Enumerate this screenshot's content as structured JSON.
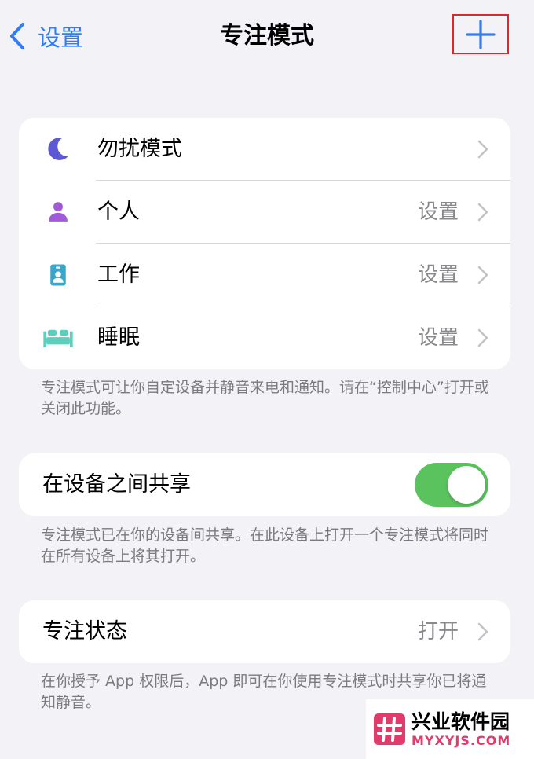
{
  "nav": {
    "back_label": "设置",
    "title": "专注模式",
    "add_icon": "plus-icon"
  },
  "focus_modes": [
    {
      "label": "勿扰模式",
      "value": "",
      "icon": "moon-icon",
      "color": "#5c58d6"
    },
    {
      "label": "个人",
      "value": "设置",
      "icon": "person-icon",
      "color": "#a25bd8"
    },
    {
      "label": "工作",
      "value": "设置",
      "icon": "badge-icon",
      "color": "#3aa7c9"
    },
    {
      "label": "睡眠",
      "value": "设置",
      "icon": "bed-icon",
      "color": "#5dcfbd"
    }
  ],
  "focus_note": "专注模式可让你自定设备并静音来电和通知。请在“控制中心”打开或关闭此功能。",
  "share": {
    "label": "在设备之间共享",
    "enabled": true,
    "note": "专注模式已在你的设备间共享。在此设备上打开一个专注模式将同时在所有设备上将其打开。"
  },
  "status": {
    "label": "专注状态",
    "value": "打开",
    "note": "在你授予 App 权限后，App 即可在你使用专注模式时共享你已将通知静音。"
  },
  "watermark": {
    "cn": "兴业软件园",
    "en": "MYXYJS.COM"
  },
  "colors": {
    "accent": "#2f7cf6",
    "toggle_on": "#5ac35e",
    "highlight_border": "#e0262a"
  }
}
